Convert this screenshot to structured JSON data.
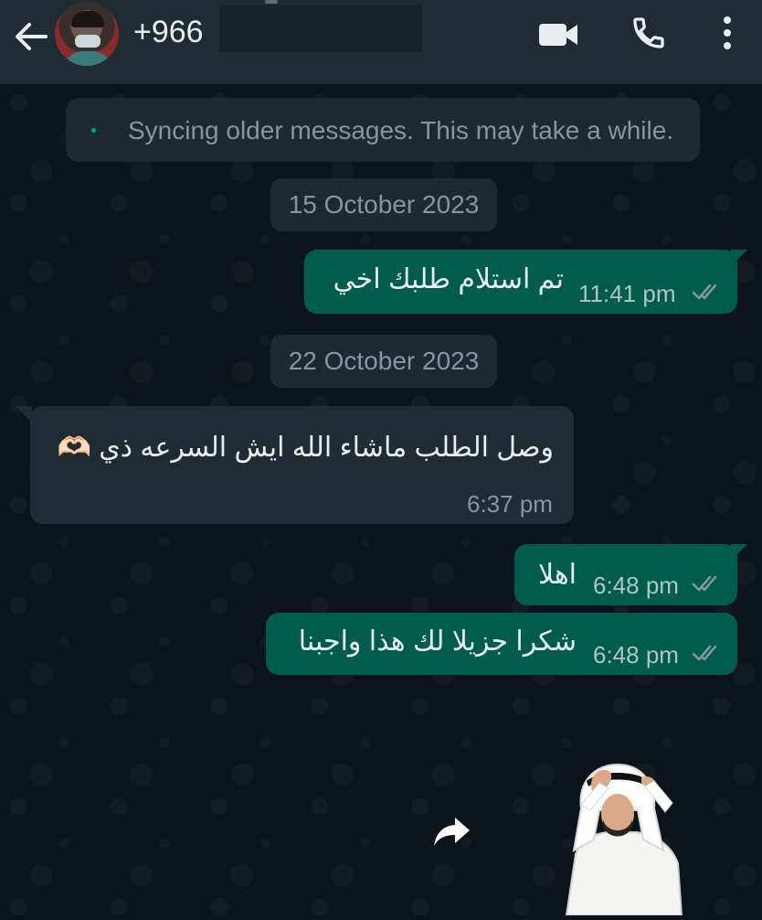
{
  "header": {
    "contact_name": "+966",
    "colors": {
      "background": "#1f2c34",
      "text": "#e9edef"
    },
    "icons": {
      "back": "arrow-left-icon",
      "video": "video-camera-icon",
      "call": "phone-icon",
      "menu": "more-vertical-icon"
    }
  },
  "sync_banner": {
    "text": "Syncing older messages. This may take a while."
  },
  "dates": [
    "15 October 2023",
    "22 October 2023"
  ],
  "messages": [
    {
      "direction": "outgoing",
      "text": "تم استلام طلبك اخي",
      "time": "11:41 pm",
      "status": "read"
    },
    {
      "direction": "incoming",
      "text": "وصل الطلب ماشاء الله ايش السرعه ذي 🫶🏻",
      "time": "6:37 pm"
    },
    {
      "direction": "outgoing",
      "text": "اهلا",
      "time": "6:48 pm",
      "status": "read"
    },
    {
      "direction": "outgoing",
      "text": "شكرا جزيلا لك هذا واجبنا",
      "time": "6:48 pm",
      "status": "read"
    }
  ],
  "sticker": {
    "icon": "sticker-man-in-ghutra-icon"
  },
  "forward": {
    "icon": "forward-arrow-icon"
  },
  "colors": {
    "chat_bg": "#0b141a",
    "outgoing_bubble": "#005c4b",
    "incoming_bubble": "#202c33",
    "accent": "#00a884",
    "read_ticks": "#8696a0"
  }
}
